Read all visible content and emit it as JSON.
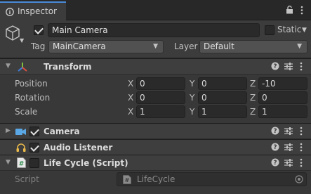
{
  "tab": {
    "title": "Inspector",
    "icon": "info-icon"
  },
  "toolbar": {
    "icons": [
      "lock-icon",
      "kebab-menu-icon"
    ]
  },
  "header": {
    "icon": "game-object-cube-icon",
    "active": true,
    "name": "Main Camera",
    "static_label": "Static",
    "static_checked": false,
    "tag_label": "Tag",
    "tag_value": "MainCamera",
    "layer_label": "Layer",
    "layer_value": "Default"
  },
  "transform": {
    "title": "Transform",
    "expanded": true,
    "rows": [
      {
        "label": "Position",
        "x": "0",
        "y": "0",
        "z": "-10"
      },
      {
        "label": "Rotation",
        "x": "0",
        "y": "0",
        "z": "0"
      },
      {
        "label": "Scale",
        "x": "1",
        "y": "1",
        "z": "1"
      }
    ],
    "axes": [
      "X",
      "Y",
      "Z"
    ]
  },
  "components": [
    {
      "title": "Camera",
      "icon": "camera-icon",
      "enabled": true,
      "expanded": false
    },
    {
      "title": "Audio Listener",
      "icon": "headphones-icon",
      "enabled": true,
      "expanded": false
    },
    {
      "title": "Life Cycle (Script)",
      "icon": "csharp-script-icon",
      "enabled": false,
      "expanded": true
    }
  ],
  "script": {
    "label": "Script",
    "value": "LifeCycle"
  },
  "colors": {
    "accent": "#4a8ad8",
    "panel": "#383838",
    "header": "#3e3e3e",
    "field": "#2a2a2a"
  }
}
